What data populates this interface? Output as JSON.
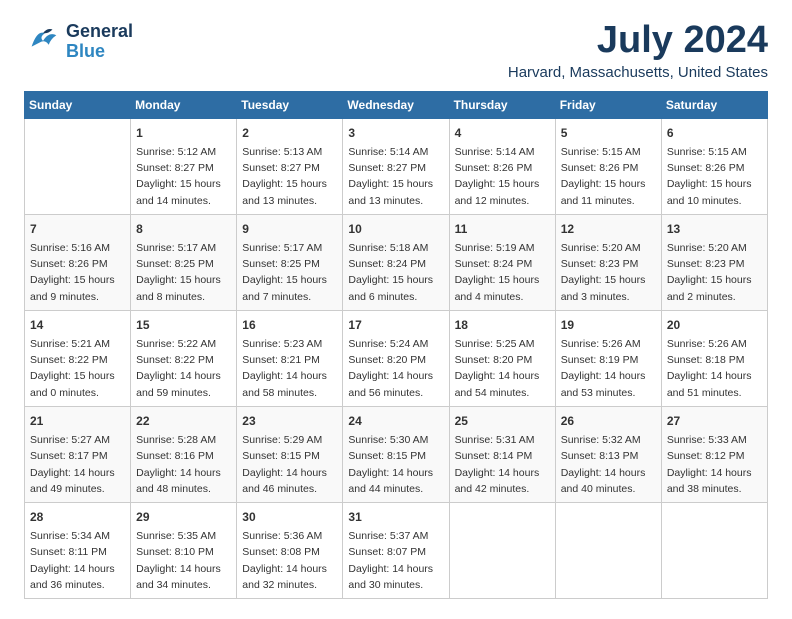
{
  "header": {
    "logo_general": "General",
    "logo_blue": "Blue",
    "title": "July 2024",
    "subtitle": "Harvard, Massachusetts, United States"
  },
  "calendar": {
    "days_of_week": [
      "Sunday",
      "Monday",
      "Tuesday",
      "Wednesday",
      "Thursday",
      "Friday",
      "Saturday"
    ],
    "weeks": [
      [
        {
          "num": "",
          "info": ""
        },
        {
          "num": "1",
          "info": "Sunrise: 5:12 AM\nSunset: 8:27 PM\nDaylight: 15 hours\nand 14 minutes."
        },
        {
          "num": "2",
          "info": "Sunrise: 5:13 AM\nSunset: 8:27 PM\nDaylight: 15 hours\nand 13 minutes."
        },
        {
          "num": "3",
          "info": "Sunrise: 5:14 AM\nSunset: 8:27 PM\nDaylight: 15 hours\nand 13 minutes."
        },
        {
          "num": "4",
          "info": "Sunrise: 5:14 AM\nSunset: 8:26 PM\nDaylight: 15 hours\nand 12 minutes."
        },
        {
          "num": "5",
          "info": "Sunrise: 5:15 AM\nSunset: 8:26 PM\nDaylight: 15 hours\nand 11 minutes."
        },
        {
          "num": "6",
          "info": "Sunrise: 5:15 AM\nSunset: 8:26 PM\nDaylight: 15 hours\nand 10 minutes."
        }
      ],
      [
        {
          "num": "7",
          "info": "Sunrise: 5:16 AM\nSunset: 8:26 PM\nDaylight: 15 hours\nand 9 minutes."
        },
        {
          "num": "8",
          "info": "Sunrise: 5:17 AM\nSunset: 8:25 PM\nDaylight: 15 hours\nand 8 minutes."
        },
        {
          "num": "9",
          "info": "Sunrise: 5:17 AM\nSunset: 8:25 PM\nDaylight: 15 hours\nand 7 minutes."
        },
        {
          "num": "10",
          "info": "Sunrise: 5:18 AM\nSunset: 8:24 PM\nDaylight: 15 hours\nand 6 minutes."
        },
        {
          "num": "11",
          "info": "Sunrise: 5:19 AM\nSunset: 8:24 PM\nDaylight: 15 hours\nand 4 minutes."
        },
        {
          "num": "12",
          "info": "Sunrise: 5:20 AM\nSunset: 8:23 PM\nDaylight: 15 hours\nand 3 minutes."
        },
        {
          "num": "13",
          "info": "Sunrise: 5:20 AM\nSunset: 8:23 PM\nDaylight: 15 hours\nand 2 minutes."
        }
      ],
      [
        {
          "num": "14",
          "info": "Sunrise: 5:21 AM\nSunset: 8:22 PM\nDaylight: 15 hours\nand 0 minutes."
        },
        {
          "num": "15",
          "info": "Sunrise: 5:22 AM\nSunset: 8:22 PM\nDaylight: 14 hours\nand 59 minutes."
        },
        {
          "num": "16",
          "info": "Sunrise: 5:23 AM\nSunset: 8:21 PM\nDaylight: 14 hours\nand 58 minutes."
        },
        {
          "num": "17",
          "info": "Sunrise: 5:24 AM\nSunset: 8:20 PM\nDaylight: 14 hours\nand 56 minutes."
        },
        {
          "num": "18",
          "info": "Sunrise: 5:25 AM\nSunset: 8:20 PM\nDaylight: 14 hours\nand 54 minutes."
        },
        {
          "num": "19",
          "info": "Sunrise: 5:26 AM\nSunset: 8:19 PM\nDaylight: 14 hours\nand 53 minutes."
        },
        {
          "num": "20",
          "info": "Sunrise: 5:26 AM\nSunset: 8:18 PM\nDaylight: 14 hours\nand 51 minutes."
        }
      ],
      [
        {
          "num": "21",
          "info": "Sunrise: 5:27 AM\nSunset: 8:17 PM\nDaylight: 14 hours\nand 49 minutes."
        },
        {
          "num": "22",
          "info": "Sunrise: 5:28 AM\nSunset: 8:16 PM\nDaylight: 14 hours\nand 48 minutes."
        },
        {
          "num": "23",
          "info": "Sunrise: 5:29 AM\nSunset: 8:15 PM\nDaylight: 14 hours\nand 46 minutes."
        },
        {
          "num": "24",
          "info": "Sunrise: 5:30 AM\nSunset: 8:15 PM\nDaylight: 14 hours\nand 44 minutes."
        },
        {
          "num": "25",
          "info": "Sunrise: 5:31 AM\nSunset: 8:14 PM\nDaylight: 14 hours\nand 42 minutes."
        },
        {
          "num": "26",
          "info": "Sunrise: 5:32 AM\nSunset: 8:13 PM\nDaylight: 14 hours\nand 40 minutes."
        },
        {
          "num": "27",
          "info": "Sunrise: 5:33 AM\nSunset: 8:12 PM\nDaylight: 14 hours\nand 38 minutes."
        }
      ],
      [
        {
          "num": "28",
          "info": "Sunrise: 5:34 AM\nSunset: 8:11 PM\nDaylight: 14 hours\nand 36 minutes."
        },
        {
          "num": "29",
          "info": "Sunrise: 5:35 AM\nSunset: 8:10 PM\nDaylight: 14 hours\nand 34 minutes."
        },
        {
          "num": "30",
          "info": "Sunrise: 5:36 AM\nSunset: 8:08 PM\nDaylight: 14 hours\nand 32 minutes."
        },
        {
          "num": "31",
          "info": "Sunrise: 5:37 AM\nSunset: 8:07 PM\nDaylight: 14 hours\nand 30 minutes."
        },
        {
          "num": "",
          "info": ""
        },
        {
          "num": "",
          "info": ""
        },
        {
          "num": "",
          "info": ""
        }
      ]
    ]
  }
}
